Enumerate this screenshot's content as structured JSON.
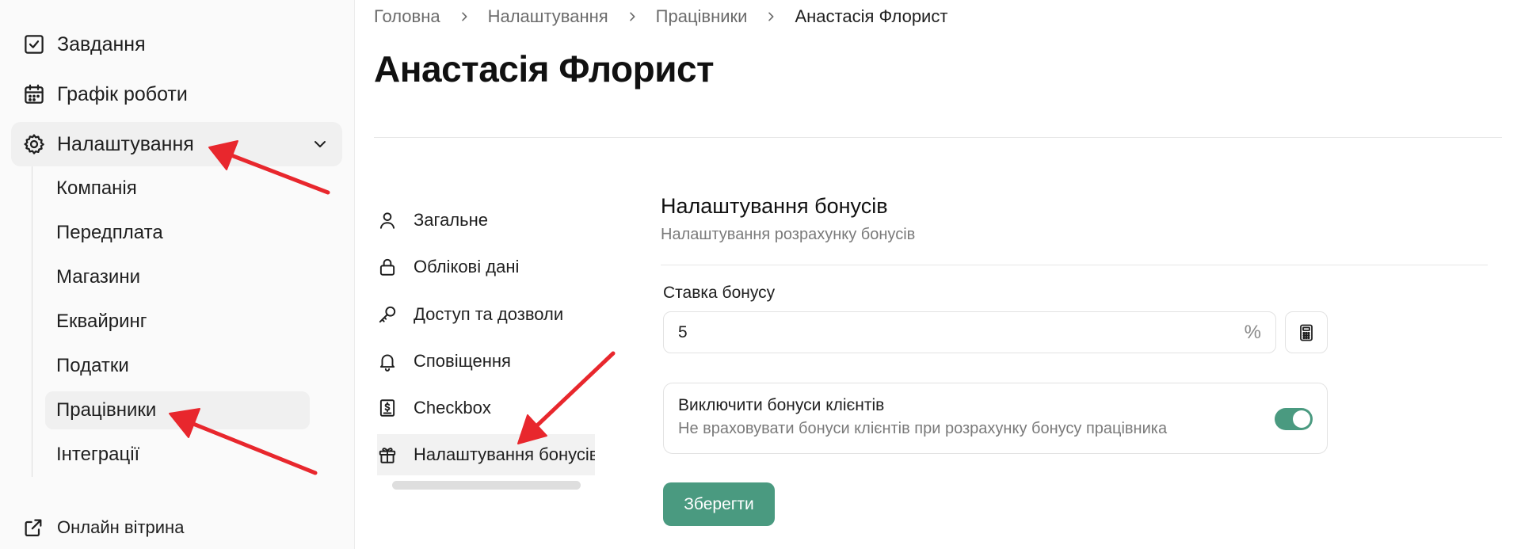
{
  "sidebar": {
    "items": [
      {
        "label": "Завдання",
        "icon": "checkbox-icon"
      },
      {
        "label": "Графік роботи",
        "icon": "calendar-icon"
      },
      {
        "label": "Налаштування",
        "icon": "gear-icon"
      }
    ],
    "settings_sub": [
      {
        "label": "Компанія"
      },
      {
        "label": "Передплата"
      },
      {
        "label": "Магазини"
      },
      {
        "label": "Еквайринг"
      },
      {
        "label": "Податки"
      },
      {
        "label": "Працівники"
      },
      {
        "label": "Інтеграції"
      }
    ],
    "external": {
      "label": "Онлайн вітрина",
      "icon": "external-link-icon"
    }
  },
  "breadcrumb": [
    "Головна",
    "Налаштування",
    "Працівники",
    "Анастасія Флорист"
  ],
  "page_title": "Анастасія Флорист",
  "tabs": [
    {
      "label": "Загальне",
      "icon": "user-icon"
    },
    {
      "label": "Облікові дані",
      "icon": "lock-icon"
    },
    {
      "label": "Доступ та дозволи",
      "icon": "key-icon"
    },
    {
      "label": "Сповіщення",
      "icon": "bell-icon"
    },
    {
      "label": "Checkbox",
      "icon": "receipt-icon"
    },
    {
      "label": "Налаштування бонусів",
      "icon": "gift-icon"
    }
  ],
  "bonus": {
    "title": "Налаштування бонусів",
    "subtitle": "Налаштування розрахунку бонусів",
    "rate_label": "Ставка бонусу",
    "rate_value": "5",
    "rate_suffix": "%",
    "exclude_title": "Виключити бонуси клієнтів",
    "exclude_desc": "Не враховувати бонуси клієнтів при розрахунку бонусу працівника",
    "exclude_enabled": true,
    "save_label": "Зберегти"
  },
  "colors": {
    "accent": "#4a9a80",
    "annotation": "#e8272d"
  }
}
